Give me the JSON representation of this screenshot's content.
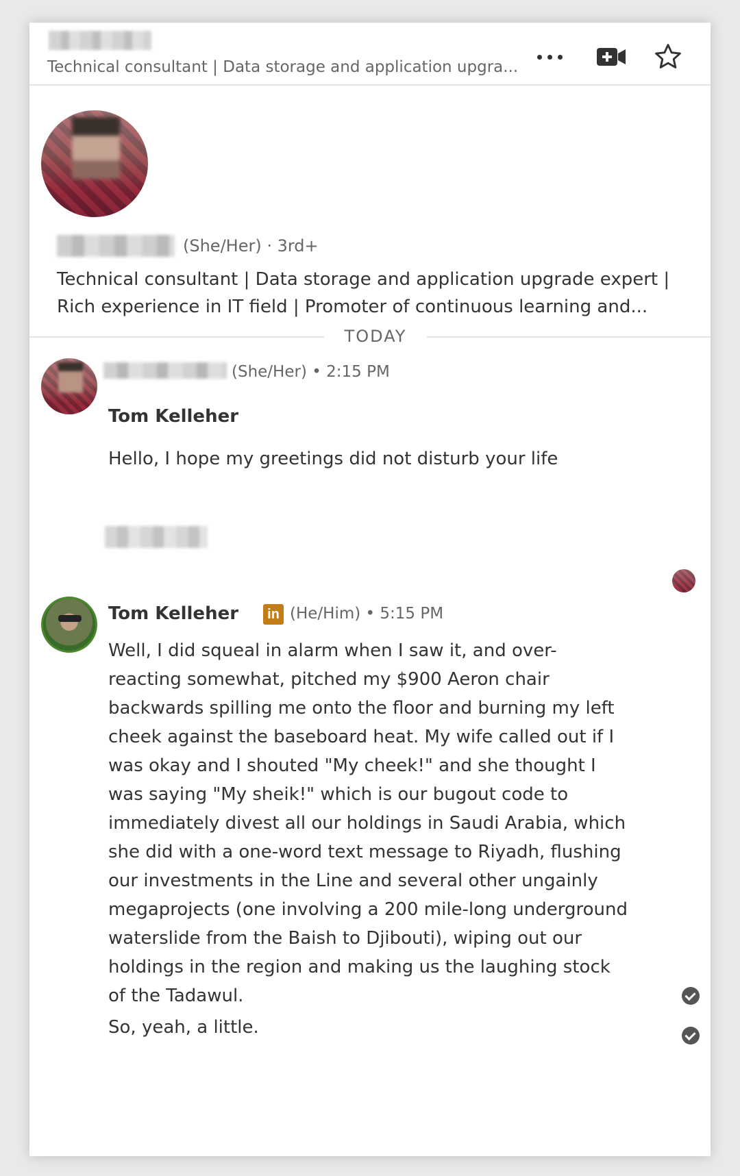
{
  "header": {
    "subtitle": "Technical consultant | Data storage and application upgra...",
    "icons": [
      "more-icon",
      "video-call-icon",
      "star-icon"
    ]
  },
  "profile": {
    "meta": "(She/Her) · 3rd+",
    "headline": "Technical consultant | Data storage and application upgrade expert | Rich experience in IT field | Promoter of continuous learning and..."
  },
  "divider": {
    "label": "TODAY"
  },
  "messages": [
    {
      "meta": "(She/Her) • 2:15 PM",
      "recipient_line": "Tom Kelleher",
      "text": "Hello, I hope my greetings did not disturb your life"
    },
    {
      "sender": "Tom Kelleher",
      "badge": "in",
      "meta": "(He/Him) • 5:15 PM",
      "text": "Well, I did squeal in alarm when I saw it, and over-reacting somewhat, pitched my $900 Aeron chair backwards spilling me onto the floor and burning my left cheek against the baseboard heat.  My wife called out if I was okay and I shouted \"My cheek!\" and she thought I was saying \"My sheik!\" which is our bugout code to immediately divest all our holdings in Saudi Arabia, which she did with a one-word text message to Riyadh, flushing our investments in the Line and several other ungainly megaprojects (one involving a 200 mile-long underground waterslide from the Baish to Djibouti), wiping out our holdings in the region and making us the laughing stock of the Tadawul.",
      "followup": "So, yeah, a little."
    }
  ],
  "colors": {
    "linkedin_badge": "#c37d16",
    "text": "#333333",
    "muted": "#666666"
  }
}
